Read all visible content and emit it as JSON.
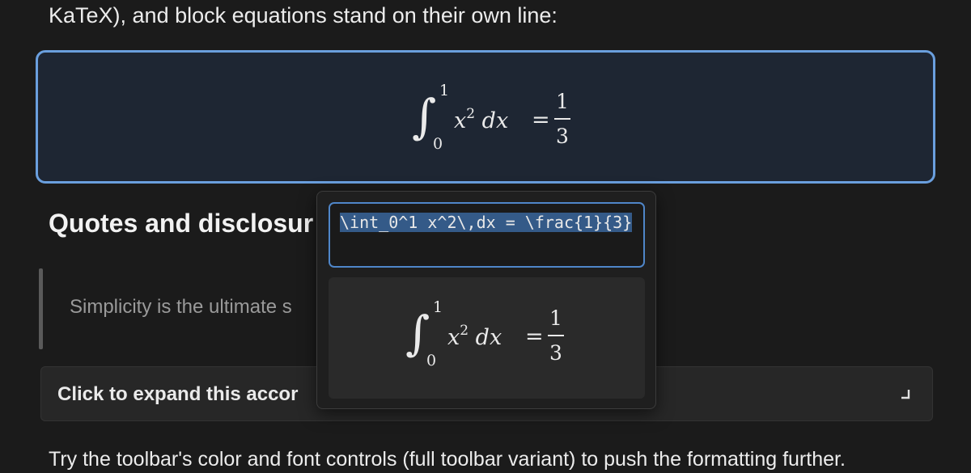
{
  "content": {
    "intro_fragment": "KaTeX), and block equations stand on their own line:",
    "block_equation": {
      "upper_limit": "1",
      "lower_limit": "0",
      "integrand": "x",
      "exponent": "2",
      "differential": "dx",
      "equals": "=",
      "numerator": "1",
      "denominator": "3"
    },
    "section_heading": "Quotes and disclosur",
    "blockquote_text": "Simplicity is the ultimate s",
    "accordion_label": "Click to expand this accor",
    "closing_paragraph": "Try the toolbar's color and font controls (full toolbar variant) to push the formatting further."
  },
  "equation_editor": {
    "latex_source": "\\int_0^1 x^2\\,dx = \\frac{1}{3}",
    "preview": {
      "upper_limit": "1",
      "lower_limit": "0",
      "integrand": "x",
      "exponent": "2",
      "differential": "dx",
      "equals": "=",
      "numerator": "1",
      "denominator": "3"
    }
  },
  "colors": {
    "accent": "#6a9fde",
    "selection": "#345a88",
    "background": "#1b1b1b"
  },
  "icons": {
    "accordion_indicator": "return-arrow-icon",
    "textarea_grip": "resize-grip-icon"
  }
}
